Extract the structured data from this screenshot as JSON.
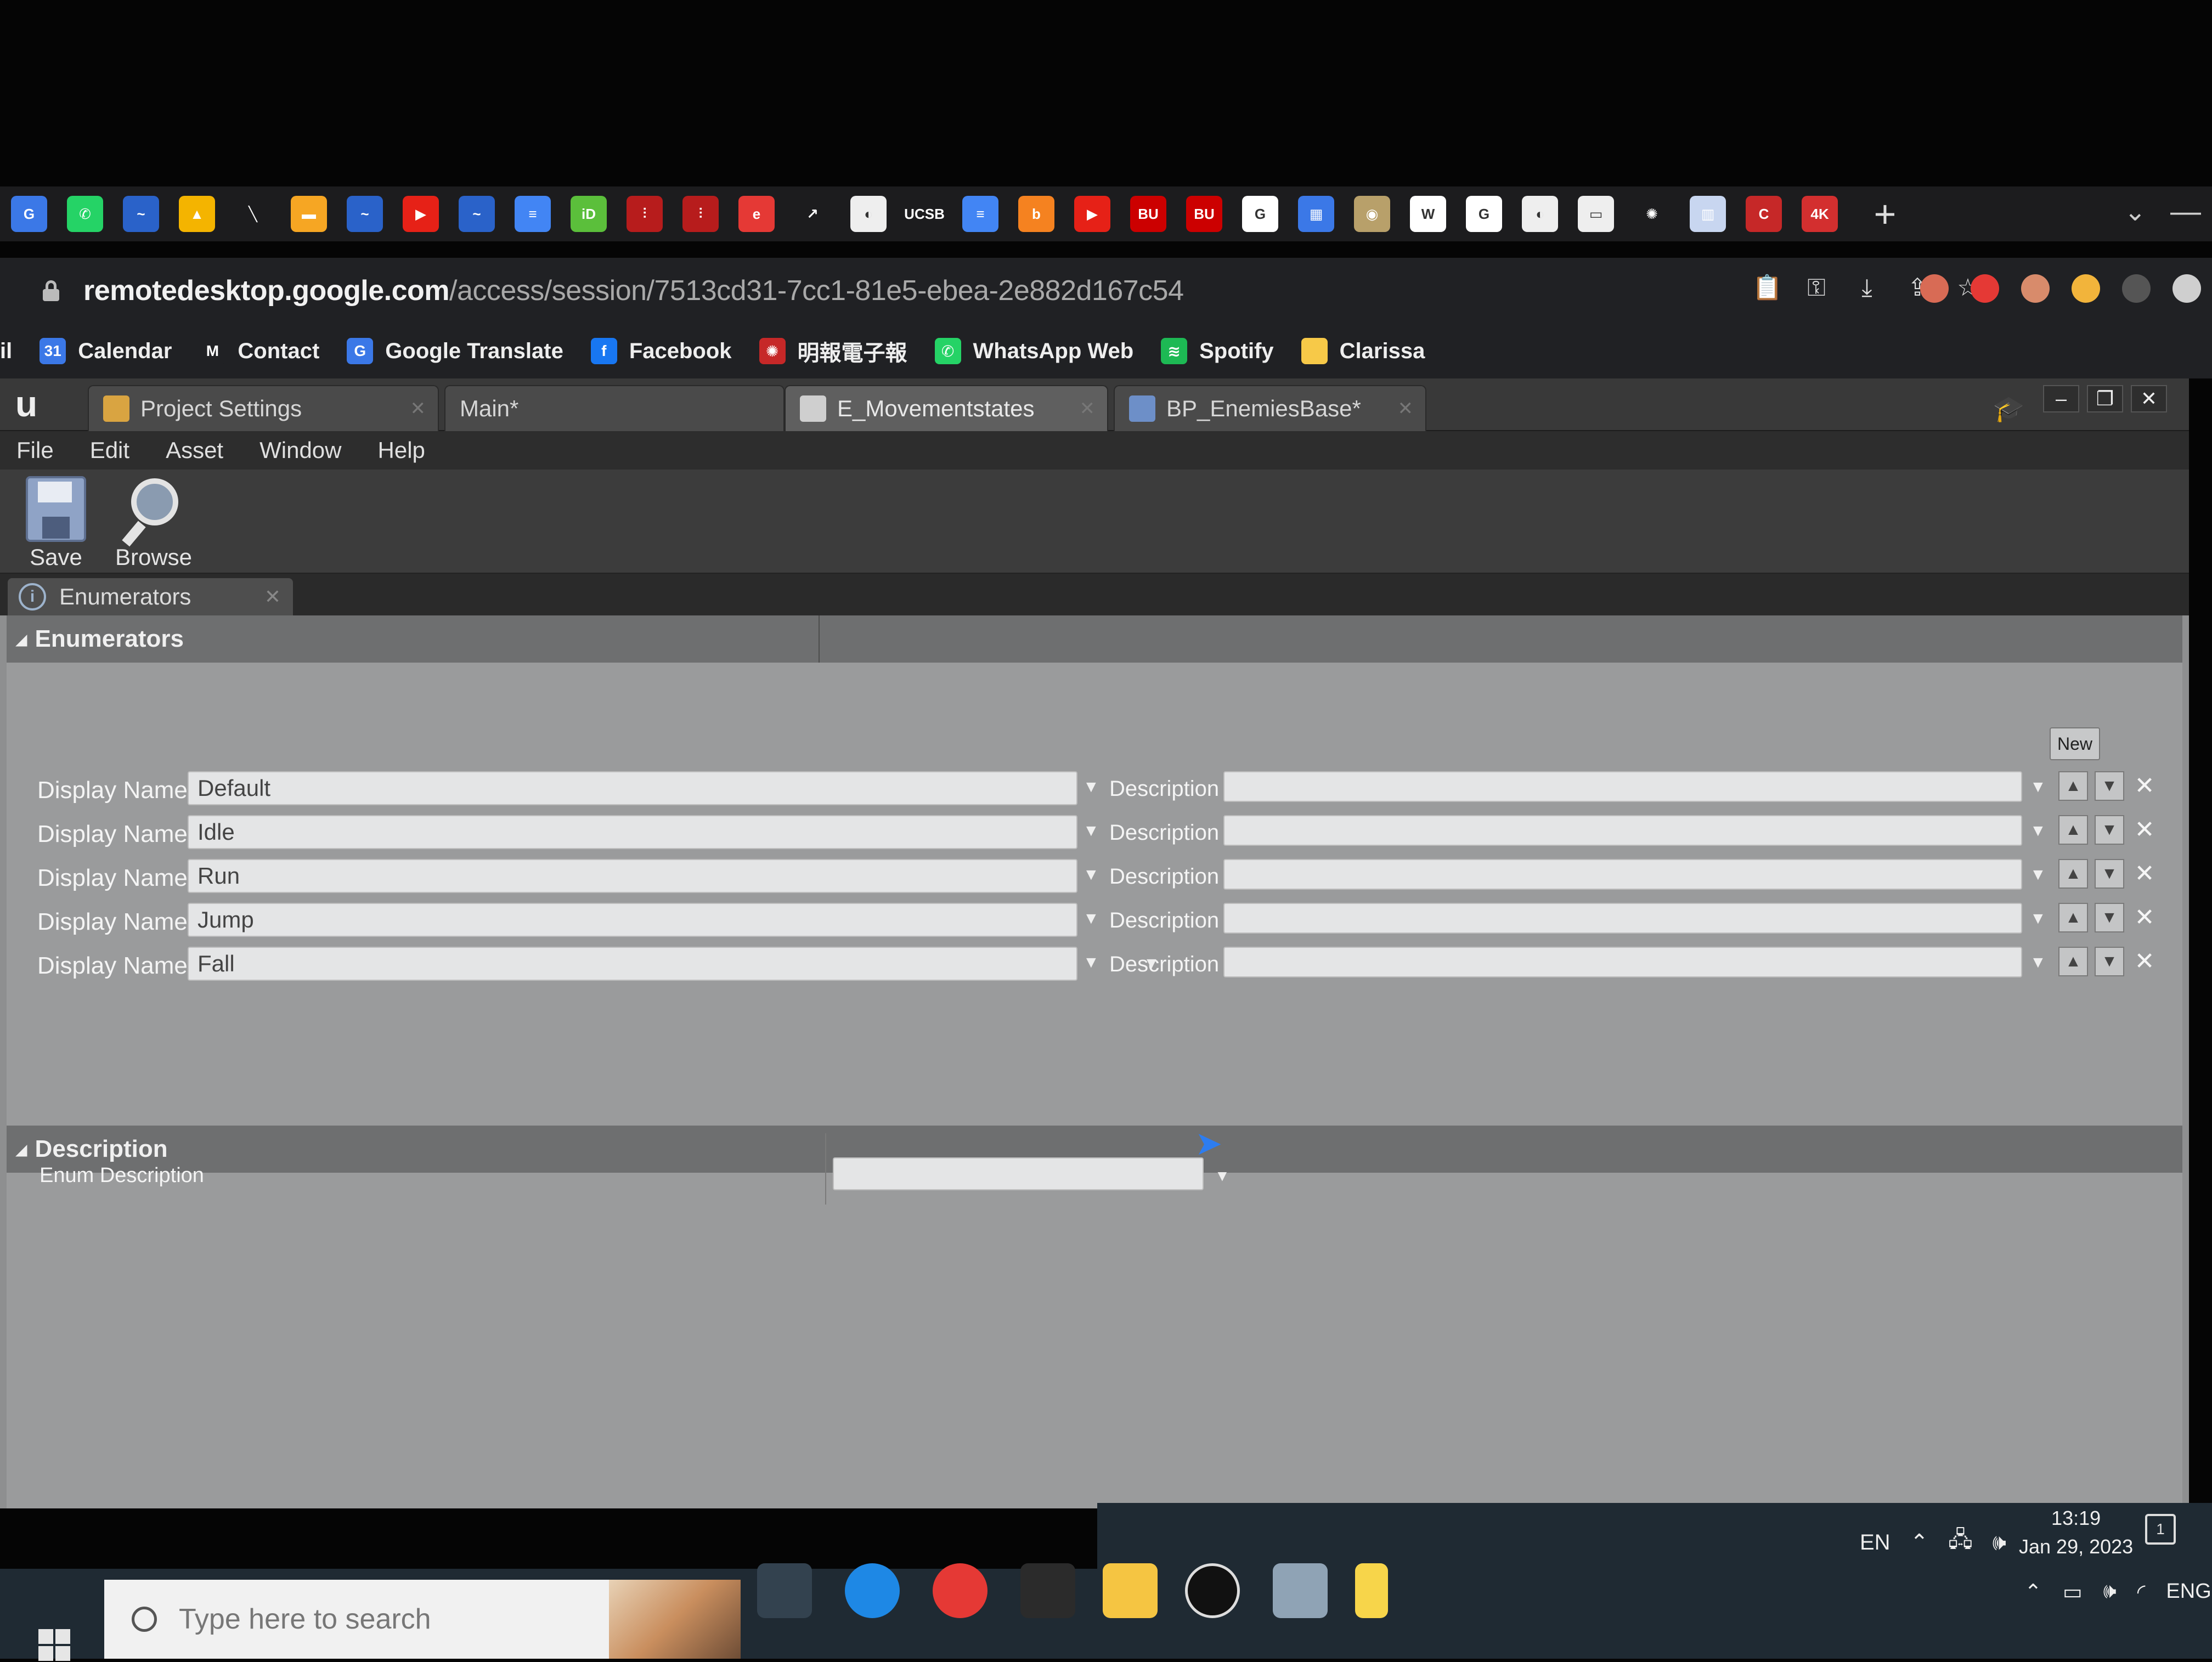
{
  "browser": {
    "url_host": "remotedesktop.google.com",
    "url_path": "/access/session/7513cd31-7cc1-81e5-ebea-2e882d167c54",
    "tab_favicons": [
      {
        "name": "translate-tab-icon",
        "color": "#3b78e7",
        "glyph": "G"
      },
      {
        "name": "whatsapp-tab-icon",
        "color": "#25d366",
        "glyph": "✆"
      },
      {
        "name": "chrome-remote-tab-icon",
        "color": "#2a62c9",
        "glyph": "~"
      },
      {
        "name": "google-drive-tab-icon",
        "color": "#f4b400",
        "glyph": "▲"
      },
      {
        "name": "pen-tab-icon",
        "color": "#1c1c1e",
        "glyph": "╲"
      },
      {
        "name": "slides-tab-icon",
        "color": "#f6a623",
        "glyph": "▬"
      },
      {
        "name": "chrome-remote-tab-icon-2",
        "color": "#2a62c9",
        "glyph": "~"
      },
      {
        "name": "youtube-tab-icon",
        "color": "#e62117",
        "glyph": "▶"
      },
      {
        "name": "chrome-remote-tab-icon-3",
        "color": "#2a62c9",
        "glyph": "~"
      },
      {
        "name": "docs-tab-icon",
        "color": "#4285f4",
        "glyph": "≡"
      },
      {
        "name": "id-tab-icon",
        "color": "#5bbf3b",
        "glyph": "iD"
      },
      {
        "name": "thermometer-tab-icon",
        "color": "#b71c1c",
        "glyph": "⫶"
      },
      {
        "name": "thermometer-tab-icon-2",
        "color": "#b71c1c",
        "glyph": "⫶"
      },
      {
        "name": "edge-tab-icon",
        "color": "#e53935",
        "glyph": "e"
      },
      {
        "name": "arrow-tab-icon",
        "color": "#1c1c1e",
        "glyph": "↗"
      },
      {
        "name": "globe-tab-icon",
        "color": "#eeeeee",
        "glyph": "◐"
      },
      {
        "name": "ucsb-tab-icon",
        "color": "#1c1c1e",
        "glyph": "UCSB"
      },
      {
        "name": "docs-tab-icon-2",
        "color": "#4285f4",
        "glyph": "≡"
      },
      {
        "name": "bing-tab-icon",
        "color": "#f58220",
        "glyph": "b"
      },
      {
        "name": "youtube-tab-icon-2",
        "color": "#e62117",
        "glyph": "▶"
      },
      {
        "name": "bu-tab-icon",
        "color": "#cc0000",
        "glyph": "BU"
      },
      {
        "name": "bu-tab-icon-2",
        "color": "#cc0000",
        "glyph": "BU"
      },
      {
        "name": "google-tab-icon",
        "color": "#ffffff",
        "glyph": "G"
      },
      {
        "name": "calendar-tab-icon",
        "color": "#3b78e7",
        "glyph": "▦"
      },
      {
        "name": "medal-tab-icon",
        "color": "#b8a06a",
        "glyph": "◉"
      },
      {
        "name": "wikipedia-tab-icon",
        "color": "#ffffff",
        "glyph": "W"
      },
      {
        "name": "google-tab-icon-2",
        "color": "#ffffff",
        "glyph": "G"
      },
      {
        "name": "globe-tab-icon-2",
        "color": "#eeeeee",
        "glyph": "◐"
      },
      {
        "name": "news-tab-icon",
        "color": "#eeeeee",
        "glyph": "▭"
      },
      {
        "name": "spark-tab-icon",
        "color": "#1c1c1e",
        "glyph": "✺"
      },
      {
        "name": "notebook-tab-icon",
        "color": "#c8d6f0",
        "glyph": "▥"
      },
      {
        "name": "c-tab-icon",
        "color": "#c62828",
        "glyph": "C"
      },
      {
        "name": "4k-tab-icon",
        "color": "#d32f2f",
        "glyph": "4K"
      }
    ],
    "new_tab_glyph": "+",
    "tab_overflow_glyph": "⌄",
    "minimize_glyph": "—",
    "address_actions": [
      "📋",
      "⚿",
      "⤓",
      "⇪",
      "☆"
    ],
    "extension_colors": [
      "#d86b55",
      "#e53935",
      "#d88b6b",
      "#f2b43b",
      "#cfcfcf"
    ],
    "bookmarks": [
      {
        "name": "bookmark-mail",
        "label": "il",
        "color": "#202124",
        "glyph": ""
      },
      {
        "name": "bookmark-calendar",
        "label": "Calendar",
        "color": "#3b78e7",
        "glyph": "31"
      },
      {
        "name": "bookmark-contact",
        "label": "Contact",
        "color": "#202124",
        "glyph": "M"
      },
      {
        "name": "bookmark-google-translate",
        "label": "Google Translate",
        "color": "#3b78e7",
        "glyph": "G"
      },
      {
        "name": "bookmark-facebook",
        "label": "Facebook",
        "color": "#1877f2",
        "glyph": "f"
      },
      {
        "name": "bookmark-mingpao",
        "label": "明報電子報",
        "color": "#c62828",
        "glyph": "✺"
      },
      {
        "name": "bookmark-whatsapp",
        "label": "WhatsApp Web",
        "color": "#25d366",
        "glyph": "✆"
      },
      {
        "name": "bookmark-spotify",
        "label": "Spotify",
        "color": "#1db954",
        "glyph": "≋"
      },
      {
        "name": "bookmark-clarissa",
        "label": "Clarissa",
        "color": "#f7c948",
        "glyph": ""
      }
    ]
  },
  "ue": {
    "tabs": [
      {
        "label": "Project Settings",
        "active": false
      },
      {
        "label": "Main*",
        "active": false
      },
      {
        "label": "E_Movementstates",
        "active": true
      },
      {
        "label": "BP_EnemiesBase*",
        "active": false
      }
    ],
    "menu": [
      "File",
      "Edit",
      "Asset",
      "Window",
      "Help"
    ],
    "toolbar": {
      "save_label": "Save",
      "browse_label": "Browse"
    },
    "panel_tab": "Enumerators",
    "enumerators_header": "Enumerators",
    "new_button": "New",
    "display_name_label": "Display Name",
    "description_label": "Description",
    "enumerators": [
      {
        "display_name": "Default",
        "description": ""
      },
      {
        "display_name": "Idle",
        "description": ""
      },
      {
        "display_name": "Run",
        "description": ""
      },
      {
        "display_name": "Jump",
        "description": ""
      },
      {
        "display_name": "Fall",
        "description": ""
      }
    ],
    "description_header": "Description",
    "enum_description_label": "Enum Description",
    "enum_description_value": ""
  },
  "taskbar": {
    "search_placeholder": "Type here to search",
    "language": "EN",
    "time": "13:19",
    "date": "Jan 29, 2023",
    "input_language": "ENG",
    "notification_count": "1"
  }
}
